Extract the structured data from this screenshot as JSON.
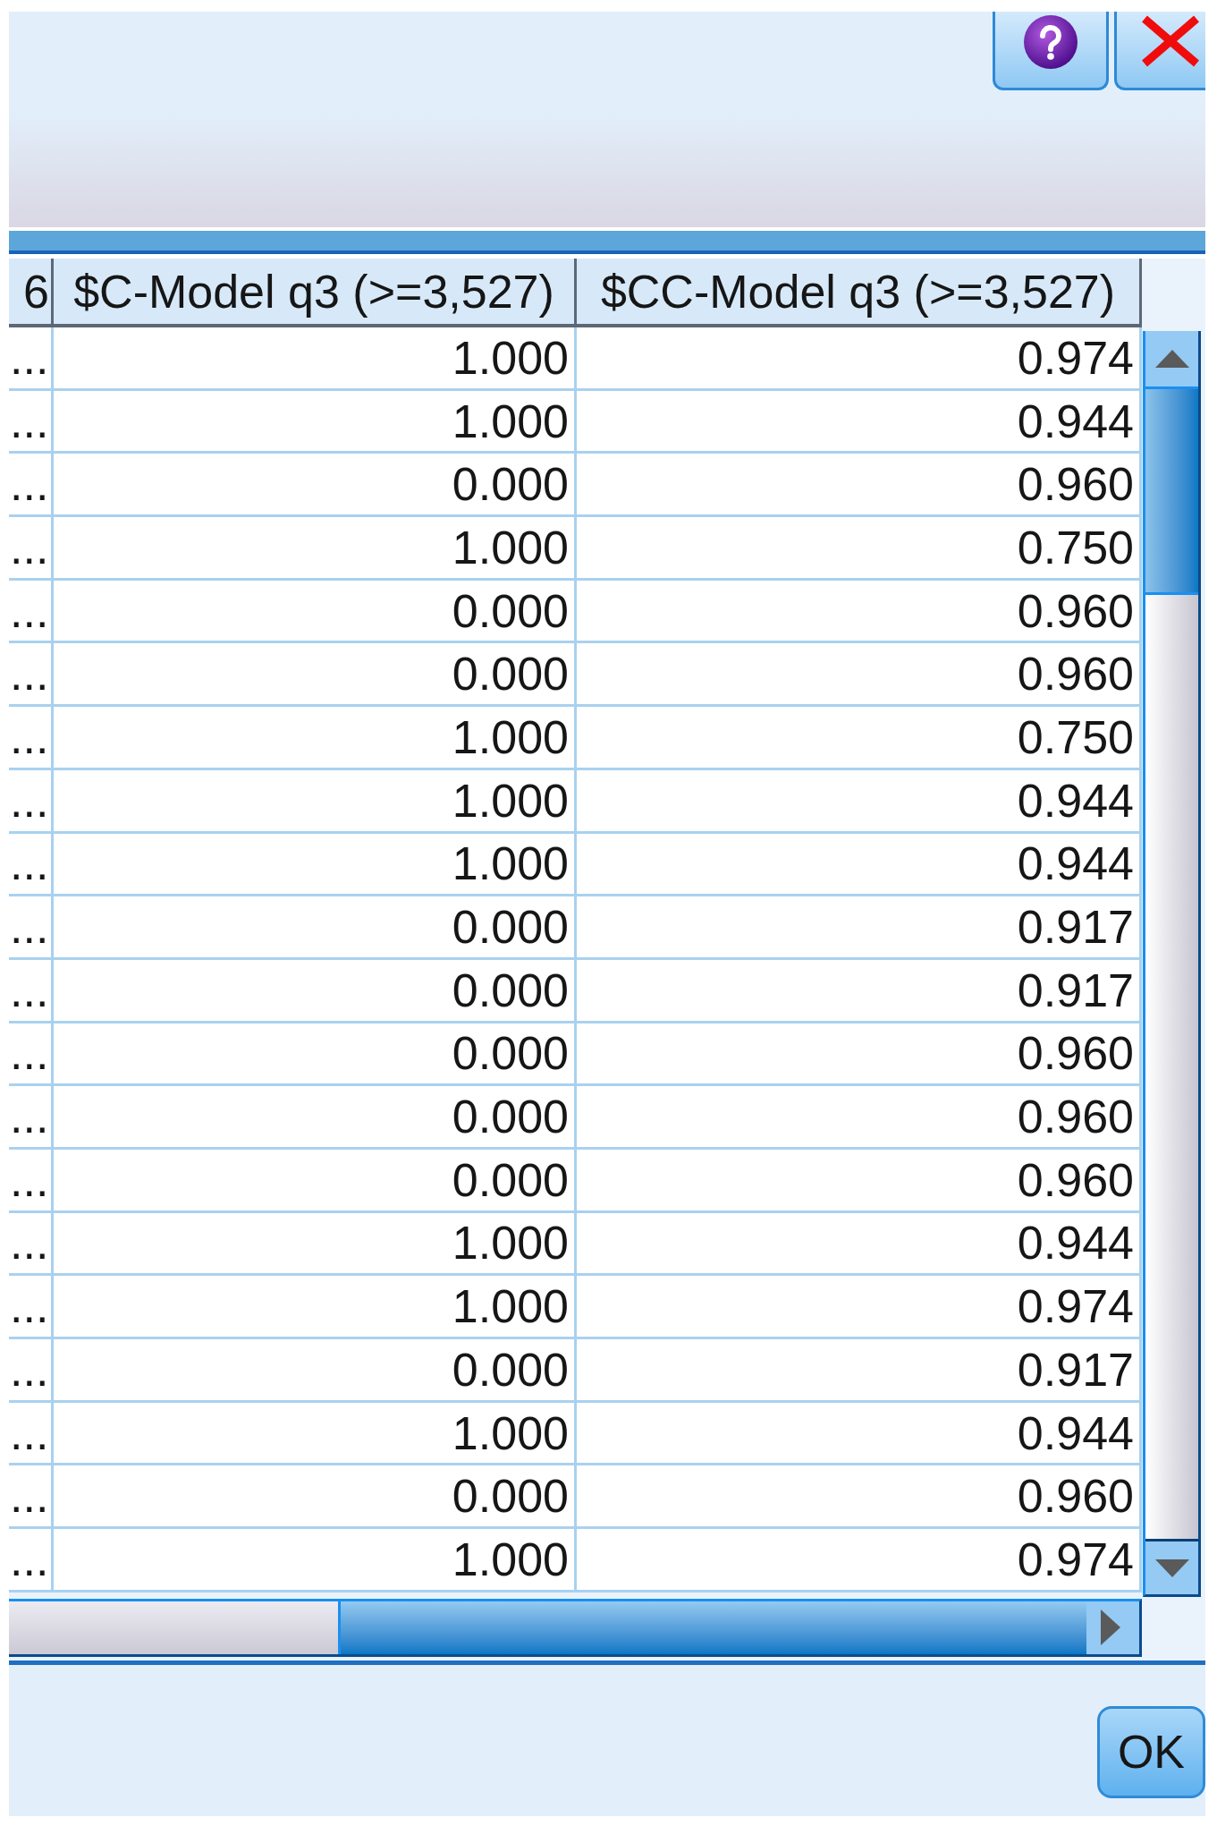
{
  "table": {
    "columns": [
      "6",
      "$C-Model q3 (>=3,527)",
      "$CC-Model q3 (>=3,527)"
    ],
    "rows": [
      [
        "...",
        "1.000",
        "0.974"
      ],
      [
        "...",
        "1.000",
        "0.944"
      ],
      [
        "...",
        "0.000",
        "0.960"
      ],
      [
        "...",
        "1.000",
        "0.750"
      ],
      [
        "...",
        "0.000",
        "0.960"
      ],
      [
        "...",
        "0.000",
        "0.960"
      ],
      [
        "...",
        "1.000",
        "0.750"
      ],
      [
        "...",
        "1.000",
        "0.944"
      ],
      [
        "...",
        "1.000",
        "0.944"
      ],
      [
        "...",
        "0.000",
        "0.917"
      ],
      [
        "...",
        "0.000",
        "0.917"
      ],
      [
        "...",
        "0.000",
        "0.960"
      ],
      [
        "...",
        "0.000",
        "0.960"
      ],
      [
        "...",
        "0.000",
        "0.960"
      ],
      [
        "...",
        "1.000",
        "0.944"
      ],
      [
        "...",
        "1.000",
        "0.974"
      ],
      [
        "...",
        "0.000",
        "0.917"
      ],
      [
        "...",
        "1.000",
        "0.944"
      ],
      [
        "...",
        "0.000",
        "0.960"
      ],
      [
        "...",
        "1.000",
        "0.974"
      ]
    ]
  },
  "buttons": [
    "OK"
  ]
}
